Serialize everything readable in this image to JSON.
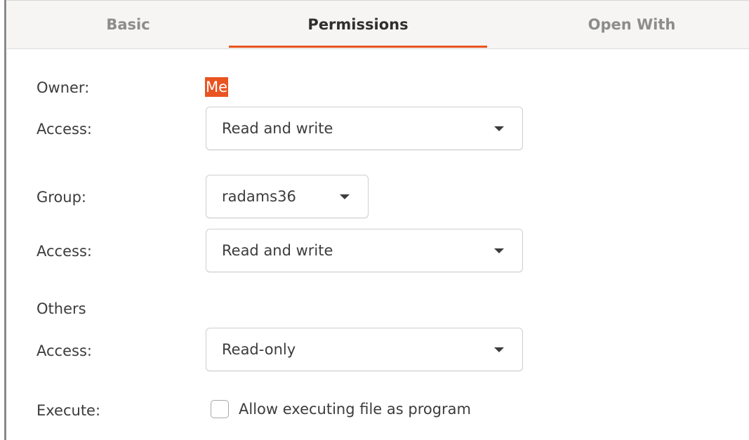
{
  "tabs": {
    "basic": "Basic",
    "permissions": "Permissions",
    "open_with": "Open With",
    "active": "Permissions"
  },
  "owner": {
    "label": "Owner:",
    "value": "Me",
    "access_label": "Access:",
    "access_value": "Read and write"
  },
  "group": {
    "label": "Group:",
    "value": "radams36",
    "access_label": "Access:",
    "access_value": "Read and write"
  },
  "others": {
    "label": "Others",
    "access_label": "Access:",
    "access_value": "Read-only"
  },
  "execute": {
    "label": "Execute:",
    "checkbox_label": "Allow executing file as program",
    "checked": false
  },
  "colors": {
    "accent": "#e95420",
    "tabbar_bg": "#f6f5f4",
    "text": "#3c3c3c",
    "inactive_tab": "#8c8c8c"
  },
  "icons": {
    "dropdown": "chevron-down-icon",
    "checkbox": "checkbox-unchecked-icon"
  }
}
